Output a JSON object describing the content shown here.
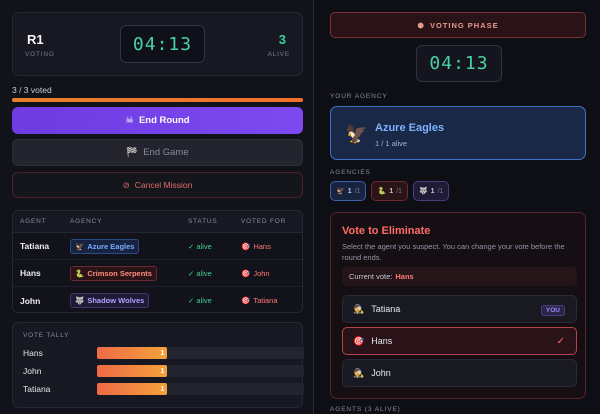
{
  "scoreboard": {
    "round_value": "R1",
    "round_label": "VOTING",
    "timer": "04:13",
    "alive_value": "3",
    "alive_label": "ALIVE"
  },
  "progress": {
    "text": "3 / 3 voted",
    "fraction": 1.0
  },
  "controls": {
    "end_round": {
      "icon": "☠",
      "label": "End Round"
    },
    "end_game": {
      "icon": "🏁",
      "label": "End Game"
    },
    "cancel": {
      "icon": "⊘",
      "label": "Cancel Mission"
    }
  },
  "agents_table": {
    "headers": [
      "AGENT",
      "AGENCY",
      "STATUS",
      "VOTED FOR"
    ],
    "rows": [
      {
        "agent": "Tatiana",
        "agency_icon": "🦅",
        "agency": "Azure Eagles",
        "status": "✓ alive",
        "voted_icon": "🎯",
        "voted_for": "Hans"
      },
      {
        "agent": "Hans",
        "agency_icon": "🐍",
        "agency": "Crimson Serpents",
        "status": "✓ alive",
        "voted_icon": "🎯",
        "voted_for": "John"
      },
      {
        "agent": "John",
        "agency_icon": "🐺",
        "agency": "Shadow Wolves",
        "status": "✓ alive",
        "voted_icon": "🎯",
        "voted_for": "Tatiana"
      }
    ]
  },
  "tally": {
    "title": "VOTE TALLY",
    "rows": [
      {
        "name": "Hans",
        "votes": "1",
        "fraction": 0.34
      },
      {
        "name": "John",
        "votes": "1",
        "fraction": 0.34
      },
      {
        "name": "Tatiana",
        "votes": "1",
        "fraction": 0.34
      }
    ]
  },
  "right": {
    "phase_icon": "⬢",
    "phase": "VOTING PHASE",
    "timer": "04:13",
    "your_agency_label": "YOUR AGENCY",
    "agency": {
      "icon": "🦅",
      "name": "Azure Eagles",
      "sub": "1 / 1 alive"
    },
    "agencies_label": "AGENCIES",
    "agency_chips": [
      {
        "icon": "🦅",
        "count": "1",
        "total": "/1"
      },
      {
        "icon": "🐍",
        "count": "1",
        "total": "/1"
      },
      {
        "icon": "🐺",
        "count": "1",
        "total": "/1"
      }
    ],
    "vote": {
      "title": "Vote to Eliminate",
      "description": "Select the agent you suspect. You can change your vote before the round ends.",
      "current_label": "Current vote:",
      "current_value": "Hans",
      "options": [
        {
          "icon": "🕵",
          "name": "Tatiana",
          "badge": "YOU"
        },
        {
          "icon": "🎯",
          "name": "Hans",
          "check": "✓"
        },
        {
          "icon": "🕵",
          "name": "John"
        }
      ]
    },
    "agents_footer": "AGENTS (3 ALIVE)"
  },
  "colors": {
    "accent_purple": "#7c4af0",
    "timer_green": "#46d3a1",
    "alert_red": "#ff6b63",
    "agency_blue": "#7fb0ff"
  }
}
